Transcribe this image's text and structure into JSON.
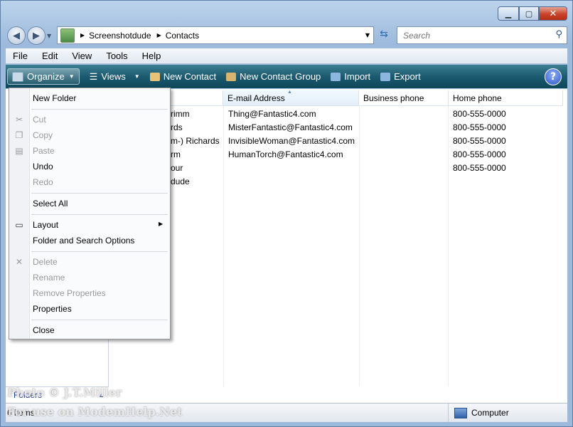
{
  "window": {
    "minimize": "▁",
    "maximize": "▢",
    "close": "✕"
  },
  "address": {
    "crumbs": [
      "Screenshotdude",
      "Contacts"
    ]
  },
  "search": {
    "placeholder": "Search"
  },
  "menubar": [
    "File",
    "Edit",
    "View",
    "Tools",
    "Help"
  ],
  "commandbar": {
    "organize": "Organize",
    "views": "Views",
    "new_contact": "New Contact",
    "new_contact_group": "New Contact Group",
    "import": "Import",
    "export": "Export",
    "help": "?"
  },
  "columns": [
    "E-mail Address",
    "Business phone",
    "Home phone"
  ],
  "rows": [
    {
      "name": "rimm",
      "email": "Thing@Fantastic4.com",
      "home": "800-555-0000"
    },
    {
      "name": "rds",
      "email": "MisterFantastic@Fantastic4.com",
      "home": "800-555-0000"
    },
    {
      "name": "m-) Richards",
      "email": "InvisibleWoman@Fantastic4.com",
      "home": "800-555-0000"
    },
    {
      "name": "rm",
      "email": "HumanTorch@Fantastic4.com",
      "home": "800-555-0000"
    },
    {
      "name": "our",
      "email": "",
      "home": "800-555-0000"
    },
    {
      "name": "dude",
      "email": "",
      "home": ""
    }
  ],
  "organize_menu": {
    "new_folder": "New Folder",
    "cut": "Cut",
    "copy": "Copy",
    "paste": "Paste",
    "undo": "Undo",
    "redo": "Redo",
    "select_all": "Select All",
    "layout": "Layout",
    "folder_options": "Folder and Search Options",
    "delete": "Delete",
    "rename": "Rename",
    "remove_properties": "Remove Properties",
    "properties": "Properties",
    "close": "Close"
  },
  "folders_label": "Folders",
  "status": {
    "count": "6 items",
    "location": "Computer"
  },
  "watermark": [
    "Photo © J.T.Miller",
    "For use on ModemHelp.Net"
  ]
}
